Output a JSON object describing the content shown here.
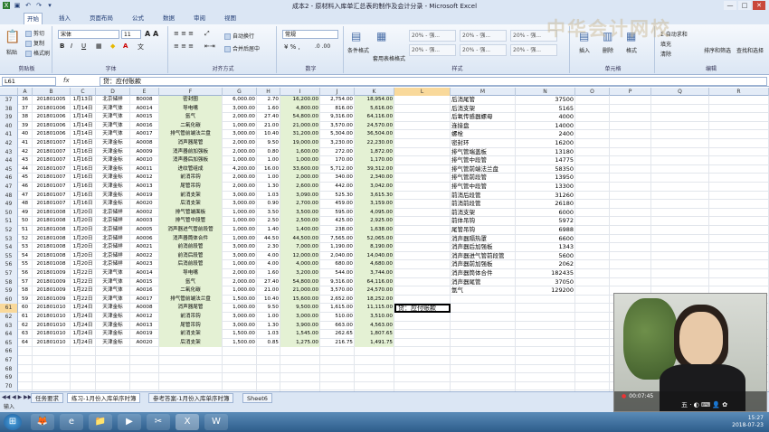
{
  "window": {
    "title": "成本2 - 原材料入库单汇总表的制作及会计分录 - Microsoft Excel"
  },
  "quick_access": [
    "save",
    "undo",
    "redo",
    "dropdown"
  ],
  "ribbon_tabs": [
    "开始",
    "插入",
    "页面布局",
    "公式",
    "数据",
    "审阅",
    "视图"
  ],
  "ribbon": {
    "clipboard": {
      "paste": "粘贴",
      "cut": "剪切",
      "copy": "复制",
      "format_painter": "格式刷",
      "label": "剪贴板"
    },
    "font": {
      "name": "宋体",
      "size": "11",
      "label": "字体"
    },
    "alignment": {
      "wrap": "自动换行",
      "merge": "合并后居中",
      "label": "对齐方式"
    },
    "number": {
      "format": "常规",
      "label": "数字"
    },
    "styles": {
      "conditional": "条件格式",
      "table": "套用表格格式",
      "presets": [
        "20% - 强...",
        "20% - 强...",
        "20% - 强...",
        "20% - 强...",
        "20% - 强...",
        "20% - 强..."
      ],
      "label": "样式"
    },
    "cells": {
      "insert": "插入",
      "delete": "删除",
      "format": "格式",
      "label": "单元格"
    },
    "editing": {
      "autosum": "Σ 自动求和",
      "fill": "填充",
      "clear": "清除",
      "sort": "排序和筛选",
      "find": "查找和选择",
      "label": "编辑"
    }
  },
  "watermark": "中华会计网校",
  "formula_bar": {
    "cell": "L61",
    "fx": "fx",
    "content": "贷：应付账款"
  },
  "columns": [
    "A",
    "B",
    "C",
    "D",
    "E",
    "F",
    "G",
    "H",
    "I",
    "J",
    "K",
    "L",
    "M",
    "N",
    "O",
    "P",
    "Q",
    "R"
  ],
  "rows": [
    {
      "n": "37",
      "a": "36",
      "b": "201801005",
      "c": "1月13日",
      "d": "北京储祥",
      "e": "B0008",
      "f": "密封圈",
      "g": "6,000.00",
      "h": "2.70",
      "i": "16,200.00",
      "j": "2,754.00",
      "k": "18,954.00",
      "m": "后消尾管",
      "nv": "37500"
    },
    {
      "n": "38",
      "a": "37",
      "b": "201801006",
      "c": "1月14日",
      "d": "天津气体",
      "e": "A0014",
      "f": "导电嘴",
      "g": "3,000.00",
      "h": "1.60",
      "i": "4,800.00",
      "j": "816.00",
      "k": "5,616.00",
      "m": "后消支架",
      "nv": "5165"
    },
    {
      "n": "39",
      "a": "38",
      "b": "201801006",
      "c": "1月14日",
      "d": "天津气体",
      "e": "A0015",
      "f": "氩气",
      "g": "2,000.00",
      "h": "27.40",
      "i": "54,800.00",
      "j": "9,316.00",
      "k": "64,116.00",
      "m": "后氧传感器螺母",
      "nv": "4000"
    },
    {
      "n": "40",
      "a": "39",
      "b": "201801006",
      "c": "1月14日",
      "d": "天津气体",
      "e": "A0016",
      "f": "二氧化碳",
      "g": "1,000.00",
      "h": "21.00",
      "i": "21,000.00",
      "j": "3,570.00",
      "k": "24,570.00",
      "m": "连接盘",
      "nv": "14000"
    },
    {
      "n": "41",
      "a": "40",
      "b": "201801006",
      "c": "1月14日",
      "d": "天津气体",
      "e": "A0017",
      "f": "排气管前端法兰盘",
      "g": "3,000.00",
      "h": "10.40",
      "i": "31,200.00",
      "j": "5,304.00",
      "k": "36,504.00",
      "m": "螺栓",
      "nv": "2400"
    },
    {
      "n": "42",
      "a": "41",
      "b": "201801007",
      "c": "1月16日",
      "d": "天津金标",
      "e": "A0008",
      "f": "消声器尾管",
      "g": "2,000.00",
      "h": "9.50",
      "i": "19,000.00",
      "j": "3,230.00",
      "k": "22,230.00",
      "m": "密封环",
      "nv": "16200"
    },
    {
      "n": "43",
      "a": "42",
      "b": "201801007",
      "c": "1月16日",
      "d": "天津金标",
      "e": "A0009",
      "f": "消声器前加强板",
      "g": "2,000.00",
      "h": "0.80",
      "i": "1,600.00",
      "j": "272.00",
      "k": "1,872.00",
      "m": "排气管端盖板",
      "nv": "13180"
    },
    {
      "n": "44",
      "a": "43",
      "b": "201801007",
      "c": "1月16日",
      "d": "天津金标",
      "e": "A0010",
      "f": "消声器后加强板",
      "g": "1,000.00",
      "h": "1.00",
      "i": "1,000.00",
      "j": "170.00",
      "k": "1,170.00",
      "m": "排气管中段管",
      "nv": "14775"
    },
    {
      "n": "45",
      "a": "44",
      "b": "201801007",
      "c": "1月16日",
      "d": "天津金标",
      "e": "A0011",
      "f": "进纹管组成",
      "g": "4,200.00",
      "h": "16.00",
      "i": "33,600.00",
      "j": "5,712.00",
      "k": "39,312.00",
      "m": "排气管前端法兰盘",
      "nv": "58350"
    },
    {
      "n": "46",
      "a": "45",
      "b": "201801007",
      "c": "1月16日",
      "d": "天津金标",
      "e": "A0012",
      "f": "前消吊钩",
      "g": "2,000.00",
      "h": "1.00",
      "i": "2,000.00",
      "j": "340.00",
      "k": "2,340.00",
      "m": "排气管前段管",
      "nv": "13950"
    },
    {
      "n": "47",
      "a": "46",
      "b": "201801007",
      "c": "1月16日",
      "d": "天津金标",
      "e": "A0013",
      "f": "尾管吊钩",
      "g": "2,000.00",
      "h": "1.30",
      "i": "2,600.00",
      "j": "442.00",
      "k": "3,042.00",
      "m": "排气管中段管",
      "nv": "13300"
    },
    {
      "n": "48",
      "a": "47",
      "b": "201801007",
      "c": "1月16日",
      "d": "天津金标",
      "e": "A0019",
      "f": "前消支架",
      "g": "3,000.00",
      "h": "1.03",
      "i": "3,090.00",
      "j": "525.30",
      "k": "3,615.30",
      "m": "前消后段管",
      "nv": "31260"
    },
    {
      "n": "49",
      "a": "48",
      "b": "201801007",
      "c": "1月16日",
      "d": "天津金标",
      "e": "A0020",
      "f": "后消支架",
      "g": "3,000.00",
      "h": "0.90",
      "i": "2,700.00",
      "j": "459.00",
      "k": "3,159.00",
      "m": "前消前段管",
      "nv": "26180"
    },
    {
      "n": "50",
      "a": "49",
      "b": "201801008",
      "c": "1月20日",
      "d": "北京储祥",
      "e": "A0002",
      "f": "排气管端面板",
      "g": "1,000.00",
      "h": "3.50",
      "i": "3,500.00",
      "j": "595.00",
      "k": "4,095.00",
      "m": "前消支架",
      "nv": "6000"
    },
    {
      "n": "51",
      "a": "50",
      "b": "201801008",
      "c": "1月20日",
      "d": "北京储祥",
      "e": "A0003",
      "f": "排气管中段管",
      "g": "1,000.00",
      "h": "2.50",
      "i": "2,500.00",
      "j": "425.00",
      "k": "2,925.00",
      "m": "前体吊钩",
      "nv": "5972"
    },
    {
      "n": "52",
      "a": "51",
      "b": "201801008",
      "c": "1月20日",
      "d": "北京储祥",
      "e": "A0005",
      "f": "消声器进气管前段管",
      "g": "1,000.00",
      "h": "1.40",
      "i": "1,400.00",
      "j": "238.00",
      "k": "1,638.00",
      "m": "尾管吊钩",
      "nv": "6988"
    },
    {
      "n": "53",
      "a": "52",
      "b": "201801008",
      "c": "1月20日",
      "d": "北京储祥",
      "e": "A0006",
      "f": "消声器筒体合件",
      "g": "1,000.00",
      "h": "44.50",
      "i": "44,500.00",
      "j": "7,565.00",
      "k": "52,065.00",
      "m": "消声器隔热罩",
      "nv": "6600"
    },
    {
      "n": "54",
      "a": "53",
      "b": "201801008",
      "c": "1月20日",
      "d": "北京储祥",
      "e": "A0021",
      "f": "前消前段管",
      "g": "3,000.00",
      "h": "2.30",
      "i": "7,000.00",
      "j": "1,190.00",
      "k": "8,190.00",
      "m": "消声器后加强板",
      "nv": "1343"
    },
    {
      "n": "55",
      "a": "54",
      "b": "201801008",
      "c": "1月20日",
      "d": "北京储祥",
      "e": "A0022",
      "f": "前消后段管",
      "g": "3,000.00",
      "h": "4.00",
      "i": "12,000.00",
      "j": "2,040.00",
      "k": "14,040.00",
      "m": "消声器进气管前段管",
      "nv": "5600"
    },
    {
      "n": "56",
      "a": "55",
      "b": "201801008",
      "c": "1月20日",
      "d": "北京储祥",
      "e": "A0023",
      "f": "后消前段管",
      "g": "1,000.00",
      "h": "4.00",
      "i": "4,000.00",
      "j": "680.00",
      "k": "4,680.00",
      "m": "消声器前加强板",
      "nv": "2062"
    },
    {
      "n": "57",
      "a": "56",
      "b": "201801009",
      "c": "1月22日",
      "d": "天津气体",
      "e": "A0014",
      "f": "导电嘴",
      "g": "2,000.00",
      "h": "1.60",
      "i": "3,200.00",
      "j": "544.00",
      "k": "3,744.00",
      "m": "消声器筒体合件",
      "nv": "182435"
    },
    {
      "n": "58",
      "a": "57",
      "b": "201801009",
      "c": "1月22日",
      "d": "天津气体",
      "e": "A0015",
      "f": "氩气",
      "g": "2,000.00",
      "h": "27.40",
      "i": "54,800.00",
      "j": "9,316.00",
      "k": "64,116.00",
      "m": "消声器尾管",
      "nv": "37050"
    },
    {
      "n": "59",
      "a": "58",
      "b": "201801009",
      "c": "1月22日",
      "d": "天津气体",
      "e": "A0016",
      "f": "二氧化碳",
      "g": "1,000.00",
      "h": "21.00",
      "i": "21,000.00",
      "j": "3,570.00",
      "k": "24,570.00",
      "m": "氩气",
      "nv": "129200"
    },
    {
      "n": "60",
      "a": "59",
      "b": "201801009",
      "c": "1月22日",
      "d": "天津气体",
      "e": "A0017",
      "f": "排气管前端法兰盘",
      "g": "1,500.00",
      "h": "10.40",
      "i": "15,600.00",
      "j": "2,652.00",
      "k": "18,252.00",
      "m": "",
      "nv": ""
    },
    {
      "n": "61",
      "a": "60",
      "b": "201801010",
      "c": "1月24日",
      "d": "天津金标",
      "e": "A0008",
      "f": "消声器尾管",
      "g": "1,000.00",
      "h": "9.50",
      "i": "9,500.00",
      "j": "1,615.00",
      "k": "11,115.00",
      "m": "",
      "nv": ""
    },
    {
      "n": "62",
      "a": "61",
      "b": "201801010",
      "c": "1月24日",
      "d": "天津金标",
      "e": "A0012",
      "f": "前消吊钩",
      "g": "3,000.00",
      "h": "1.00",
      "i": "3,000.00",
      "j": "510.00",
      "k": "3,510.00",
      "m": "",
      "nv": ""
    },
    {
      "n": "63",
      "a": "62",
      "b": "201801010",
      "c": "1月24日",
      "d": "天津金标",
      "e": "A0013",
      "f": "尾管吊钩",
      "g": "3,000.00",
      "h": "1.30",
      "i": "3,900.00",
      "j": "663.00",
      "k": "4,563.00",
      "m": "",
      "nv": ""
    },
    {
      "n": "64",
      "a": "63",
      "b": "201801010",
      "c": "1月24日",
      "d": "天津金标",
      "e": "A0019",
      "f": "前消支架",
      "g": "1,500.00",
      "h": "1.03",
      "i": "1,545.00",
      "j": "262.65",
      "k": "1,807.65",
      "m": "",
      "nv": ""
    },
    {
      "n": "65",
      "a": "64",
      "b": "201801010",
      "c": "1月24日",
      "d": "天津金标",
      "e": "A0020",
      "f": "后消支架",
      "g": "1,500.00",
      "h": "0.85",
      "i": "1,275.00",
      "j": "216.75",
      "k": "1,491.75",
      "m": "",
      "nv": ""
    },
    {
      "n": "66"
    },
    {
      "n": "67"
    },
    {
      "n": "68"
    },
    {
      "n": "69"
    },
    {
      "n": "70"
    },
    {
      "n": "71"
    },
    {
      "n": "72"
    }
  ],
  "active_cell_text": "贷：应付账款",
  "sheet_tabs": [
    "任务要求",
    "练习-1月份入库单序时簿",
    "参考答案-1月份入库单序时簿",
    "Sheet6"
  ],
  "status_text": "输入",
  "taskbar": {
    "time": "15:27",
    "date": "2018-07-23"
  },
  "webcam": {
    "elapsed": "00:07:45",
    "icons": "五 · ◐ ⌨ 👤 ✿"
  }
}
